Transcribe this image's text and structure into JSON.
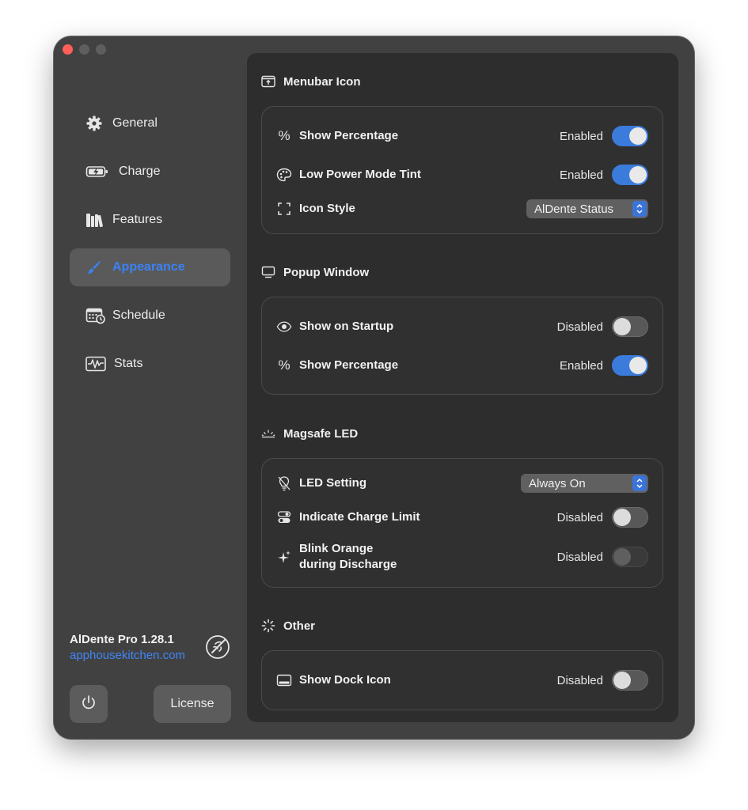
{
  "sidebar": {
    "items": [
      {
        "label": "General",
        "icon": "gear-icon"
      },
      {
        "label": "Charge",
        "icon": "battery-charging-icon"
      },
      {
        "label": "Features",
        "icon": "books-icon"
      },
      {
        "label": "Appearance",
        "icon": "paintbrush-icon",
        "active": true
      },
      {
        "label": "Schedule",
        "icon": "calendar-clock-icon"
      },
      {
        "label": "Stats",
        "icon": "waveform-icon"
      }
    ],
    "app_name": "AlDente Pro 1.28.1",
    "app_link": "apphousekitchen.com",
    "license_label": "License"
  },
  "sections": {
    "menubar": {
      "title": "Menubar Icon",
      "show_percentage": {
        "label": "Show Percentage",
        "status": "Enabled",
        "on": true
      },
      "low_power_tint": {
        "label": "Low Power Mode Tint",
        "status": "Enabled",
        "on": true
      },
      "icon_style": {
        "label": "Icon Style",
        "value": "AlDente Status"
      }
    },
    "popup": {
      "title": "Popup Window",
      "show_on_startup": {
        "label": "Show on Startup",
        "status": "Disabled",
        "on": false
      },
      "show_percentage": {
        "label": "Show Percentage",
        "status": "Enabled",
        "on": true
      }
    },
    "magsafe": {
      "title": "Magsafe LED",
      "led_setting": {
        "label": "LED Setting",
        "value": "Always On"
      },
      "indicate_charge_limit": {
        "label": "Indicate Charge Limit",
        "status": "Disabled",
        "on": false
      },
      "blink_orange": {
        "label_line1": "Blink Orange",
        "label_line2": "during Discharge",
        "status": "Disabled",
        "on": false
      }
    },
    "other": {
      "title": "Other",
      "show_dock_icon": {
        "label": "Show Dock Icon",
        "status": "Disabled",
        "on": false
      }
    }
  },
  "colors": {
    "accent": "#3a82f7",
    "toggle_on": "#3b7bdb",
    "window_bg": "#414141",
    "content_bg": "#2d2d2d"
  }
}
